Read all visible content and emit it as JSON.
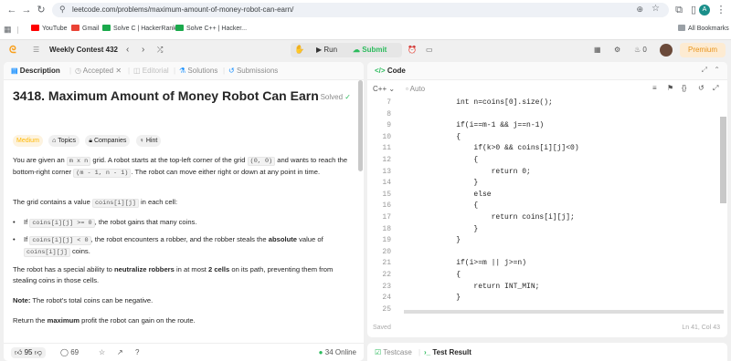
{
  "browser": {
    "url": "leetcode.com/problems/maximum-amount-of-money-robot-can-earn/",
    "profile_initial": "A",
    "bookmarks": [
      {
        "label": "YouTube",
        "color": "#ff0000"
      },
      {
        "label": "Gmail",
        "color": "#ea4335"
      },
      {
        "label": "Solve C | HackerRank",
        "color": "#1ba94c"
      },
      {
        "label": "Solve C++ | Hacker...",
        "color": "#1ba94c"
      }
    ],
    "all_bookmarks": "All Bookmarks"
  },
  "lc_header": {
    "contest": "Weekly Contest 432",
    "run": "Run",
    "submit": "Submit",
    "streak": "0",
    "premium": "Premium"
  },
  "left_tabs": {
    "description": "Description",
    "accepted": "Accepted",
    "editorial": "Editorial",
    "solutions": "Solutions",
    "submissions": "Submissions"
  },
  "problem": {
    "title": "3418. Maximum Amount of Money Robot Can Earn",
    "solved": "Solved",
    "difficulty": "Medium",
    "topics": "Topics",
    "companies": "Companies",
    "hint": "Hint",
    "p1a": "You are given an ",
    "p1_code1": "m x n",
    "p1b": " grid. A robot starts at the top-left corner of the grid ",
    "p1_code2": "(0, 0)",
    "p1c": " and wants to reach the bottom-right corner ",
    "p1_code3": "(m - 1, n - 1)",
    "p1d": ". The robot can move either right or down at any point in time.",
    "p2a": "The grid contains a value ",
    "p2_code": "coins[i][j]",
    "p2b": " in each cell:",
    "b1a": "If ",
    "b1_code": "coins[i][j] >= 0",
    "b1b": ", the robot gains that many coins.",
    "b2a": "If ",
    "b2_code1": "coins[i][j] < 0",
    "b2b": ", the robot encounters a robber, and the robber steals the ",
    "b2_bold": "absolute",
    "b2c": " value of ",
    "b2_code2": "coins[i][j]",
    "b2d": " coins.",
    "p3a": "The robot has a special ability to ",
    "p3_bold1": "neutralize robbers",
    "p3b": " in at most ",
    "p3_bold2": "2 cells",
    "p3c": " on its path, preventing them from stealing coins in those cells.",
    "note_label": "Note:",
    "note_text": " The robot's total coins can be negative.",
    "p4a": "Return the ",
    "p4_bold": "maximum",
    "p4b": " profit the robot can gain on the route."
  },
  "left_footer": {
    "likes": "95",
    "comments": "69",
    "online": "34 Online"
  },
  "code_panel": {
    "title": "Code",
    "language": "C++",
    "auto": "Auto",
    "status_left": "Saved",
    "status_right": "Ln 41, Col 43",
    "lines": [
      {
        "n": "7",
        "t": "    int n=coins[0].size();"
      },
      {
        "n": "8",
        "t": ""
      },
      {
        "n": "9",
        "t": "    if(i==m-1 && j==n-1)"
      },
      {
        "n": "10",
        "t": "    {"
      },
      {
        "n": "11",
        "t": "        if(k>0 && coins[i][j]<0)"
      },
      {
        "n": "12",
        "t": "        {"
      },
      {
        "n": "13",
        "t": "            return 0;"
      },
      {
        "n": "14",
        "t": "        }"
      },
      {
        "n": "15",
        "t": "        else"
      },
      {
        "n": "16",
        "t": "        {"
      },
      {
        "n": "17",
        "t": "            return coins[i][j];"
      },
      {
        "n": "18",
        "t": "        }"
      },
      {
        "n": "19",
        "t": "    }"
      },
      {
        "n": "20",
        "t": ""
      },
      {
        "n": "21",
        "t": "    if(i>=m || j>=n)"
      },
      {
        "n": "22",
        "t": "    {"
      },
      {
        "n": "23",
        "t": "        return INT_MIN;"
      },
      {
        "n": "24",
        "t": "    }"
      },
      {
        "n": "25",
        "t": ""
      }
    ]
  },
  "bottom_tabs": {
    "testcase": "Testcase",
    "result": "Test Result"
  }
}
